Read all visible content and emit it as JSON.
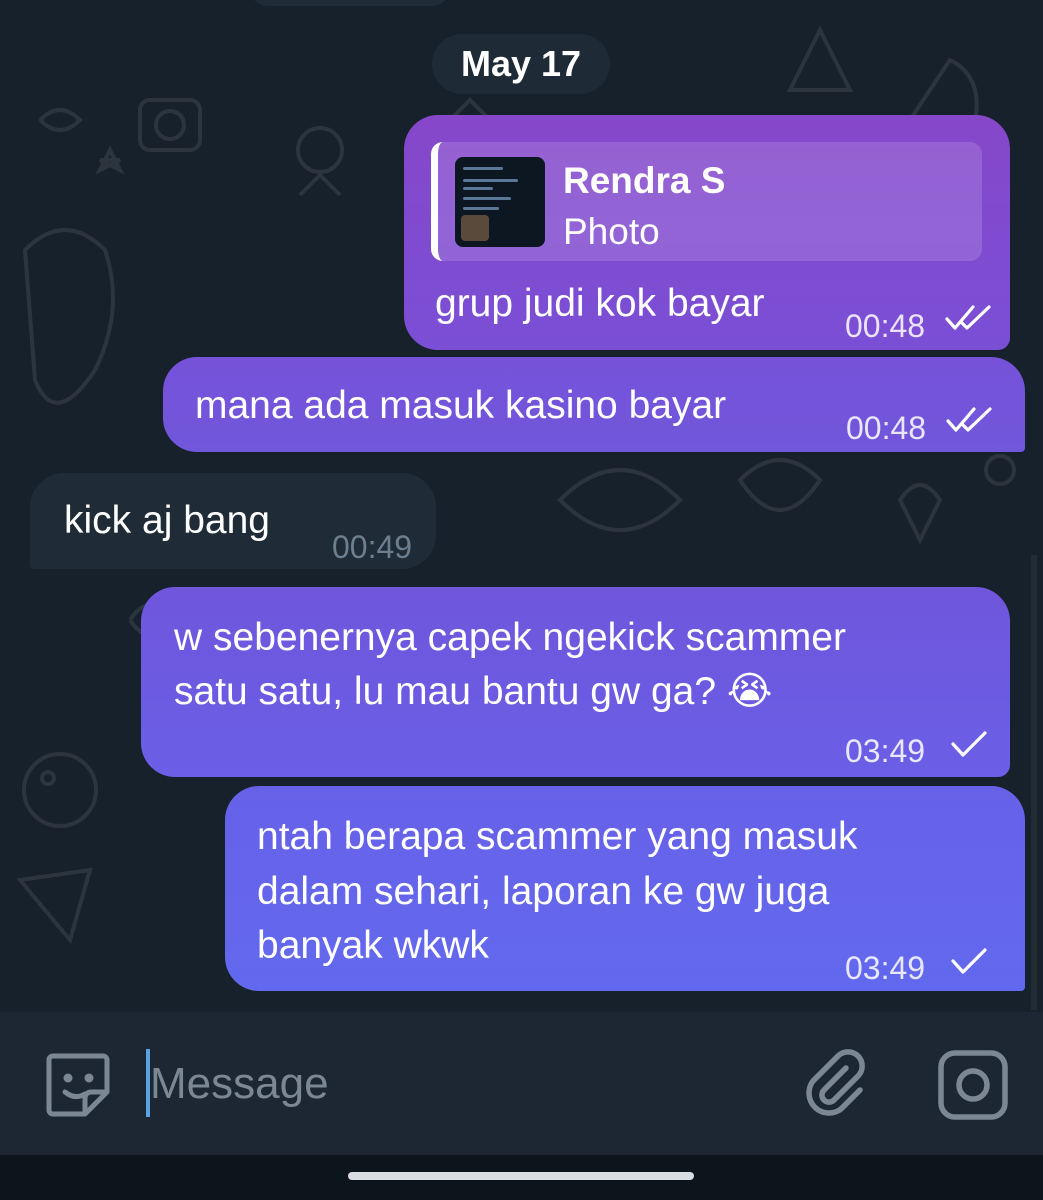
{
  "date_chip": "May 17",
  "messages": [
    {
      "direction": "outgoing",
      "reply": {
        "name": "Rendra S",
        "type": "Photo"
      },
      "text": "grup judi kok bayar",
      "time": "00:48",
      "status": "double-check-icon"
    },
    {
      "direction": "outgoing",
      "text": "mana ada masuk kasino bayar",
      "time": "00:48",
      "status": "double-check-icon"
    },
    {
      "direction": "incoming",
      "text": "kick aj bang",
      "time": "00:49"
    },
    {
      "direction": "outgoing",
      "lines": [
        "w sebenernya capek ngekick scammer",
        "satu satu, lu mau bantu gw ga? 😭"
      ],
      "time": "03:49",
      "status": "single-check-icon"
    },
    {
      "direction": "outgoing",
      "lines": [
        "ntah berapa scammer yang masuk",
        "dalam sehari, laporan ke gw juga",
        "banyak wkwk"
      ],
      "time": "03:49",
      "status": "single-check-icon"
    }
  ],
  "composer": {
    "placeholder": "Message",
    "value": ""
  },
  "icons": {
    "left": "sticker-icon",
    "attach": "paperclip-icon",
    "camera": "camera-icon"
  },
  "colors": {
    "chat_background": "#17212b",
    "outgoing_top": "#8647c9",
    "outgoing_bottom": "#6269ee",
    "incoming": "#1f2b37",
    "input_bar": "#1d2733"
  }
}
